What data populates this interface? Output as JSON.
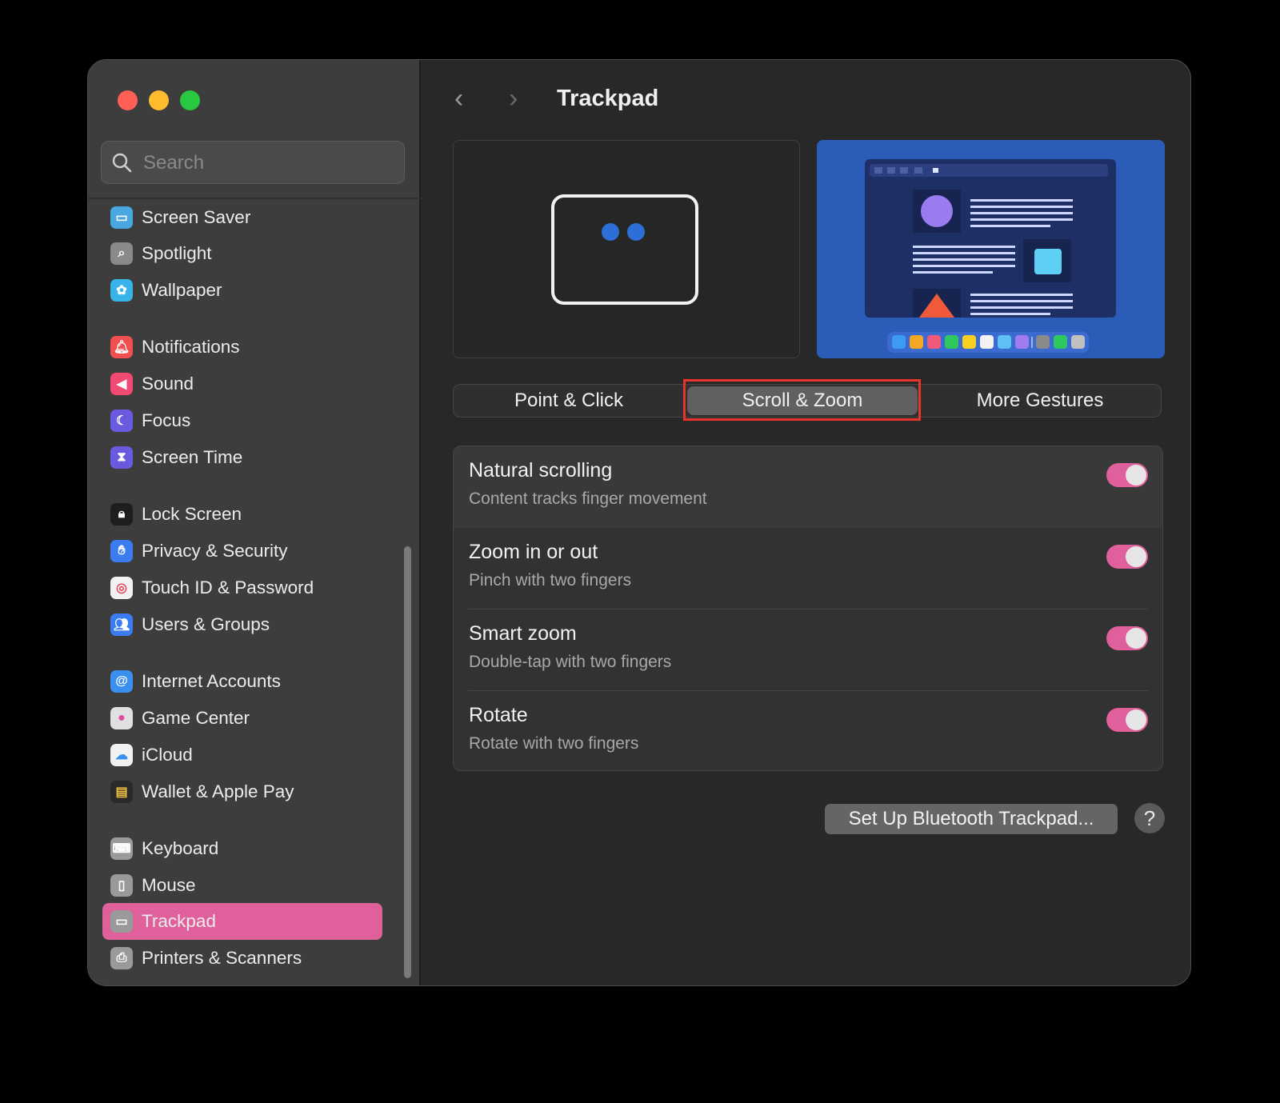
{
  "window": {
    "title": "Trackpad",
    "nav": {
      "back": "‹",
      "forward": "›"
    }
  },
  "search": {
    "placeholder": "Search",
    "value": ""
  },
  "sidebar": {
    "items": [
      {
        "label": "Screen Saver",
        "icon": "screen-saver-icon",
        "color": "#4aa8e0"
      },
      {
        "label": "Spotlight",
        "icon": "spotlight-icon",
        "color": "#8a8a8a"
      },
      {
        "label": "Wallpaper",
        "icon": "wallpaper-icon",
        "color": "#37b5e8"
      },
      {
        "label": "Notifications",
        "icon": "notifications-icon",
        "color": "#f25050"
      },
      {
        "label": "Sound",
        "icon": "sound-icon",
        "color": "#f04a72"
      },
      {
        "label": "Focus",
        "icon": "focus-icon",
        "color": "#6a5ae0"
      },
      {
        "label": "Screen Time",
        "icon": "screen-time-icon",
        "color": "#6a5ae0"
      },
      {
        "label": "Lock Screen",
        "icon": "lock-screen-icon",
        "color": "#1e1e1e"
      },
      {
        "label": "Privacy & Security",
        "icon": "privacy-hand-icon",
        "color": "#3b7df0"
      },
      {
        "label": "Touch ID & Password",
        "icon": "fingerprint-icon",
        "color": "#f2f2f2"
      },
      {
        "label": "Users & Groups",
        "icon": "users-icon",
        "color": "#3b7df0"
      },
      {
        "label": "Internet Accounts",
        "icon": "at-sign-icon",
        "color": "#3b8ff0"
      },
      {
        "label": "Game Center",
        "icon": "game-center-icon",
        "color": "#e0e0e0"
      },
      {
        "label": "iCloud",
        "icon": "icloud-icon",
        "color": "#f2f2f2"
      },
      {
        "label": "Wallet & Apple Pay",
        "icon": "wallet-icon",
        "color": "#2a2a2a"
      },
      {
        "label": "Keyboard",
        "icon": "keyboard-icon",
        "color": "#9a9a9a"
      },
      {
        "label": "Mouse",
        "icon": "mouse-icon",
        "color": "#9a9a9a"
      },
      {
        "label": "Trackpad",
        "icon": "trackpad-icon",
        "color": "#9a9a9a",
        "selected": true
      },
      {
        "label": "Printers & Scanners",
        "icon": "printer-icon",
        "color": "#9a9a9a"
      }
    ]
  },
  "tabs": [
    {
      "label": "Point & Click"
    },
    {
      "label": "Scroll & Zoom",
      "active": true
    },
    {
      "label": "More Gestures"
    }
  ],
  "settings": [
    {
      "title": "Natural scrolling",
      "subtitle": "Content tracks finger movement",
      "enabled": true
    },
    {
      "title": "Zoom in or out",
      "subtitle": "Pinch with two fingers",
      "enabled": true
    },
    {
      "title": "Smart zoom",
      "subtitle": "Double-tap with two fingers",
      "enabled": true
    },
    {
      "title": "Rotate",
      "subtitle": "Rotate with two fingers",
      "enabled": true
    }
  ],
  "buttons": {
    "bluetooth": "Set Up Bluetooth Trackpad...",
    "help": "?"
  },
  "colors": {
    "accent": "#e0609c",
    "highlight": "#e5352c",
    "traffic_close": "#ff5f57",
    "traffic_min": "#febc2e",
    "traffic_max": "#28c840"
  }
}
